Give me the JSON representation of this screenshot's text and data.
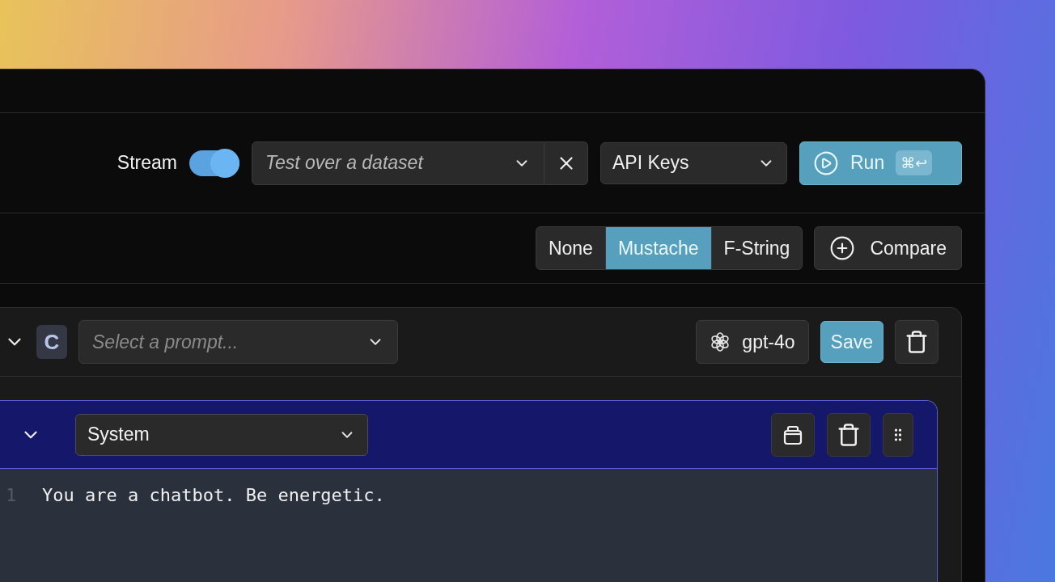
{
  "toolbar": {
    "stream": {
      "label": "Stream",
      "on": true
    },
    "dataset": {
      "placeholder": "Test over a dataset"
    },
    "api_keys": {
      "value": "API Keys"
    },
    "run": {
      "label": "Run",
      "shortcut": "⌘↩"
    }
  },
  "template_modes": [
    {
      "label": "None",
      "selected": false
    },
    {
      "label": "Mustache",
      "selected": true
    },
    {
      "label": "F-String",
      "selected": false
    }
  ],
  "compare": {
    "label": "Compare"
  },
  "prompt": {
    "badge": "C",
    "placeholder": "Select a prompt...",
    "model": "gpt-4o",
    "save": "Save"
  },
  "message": {
    "role": "System",
    "lines": [
      {
        "number": "1",
        "text": "You are a chatbot. Be energetic."
      }
    ]
  }
}
